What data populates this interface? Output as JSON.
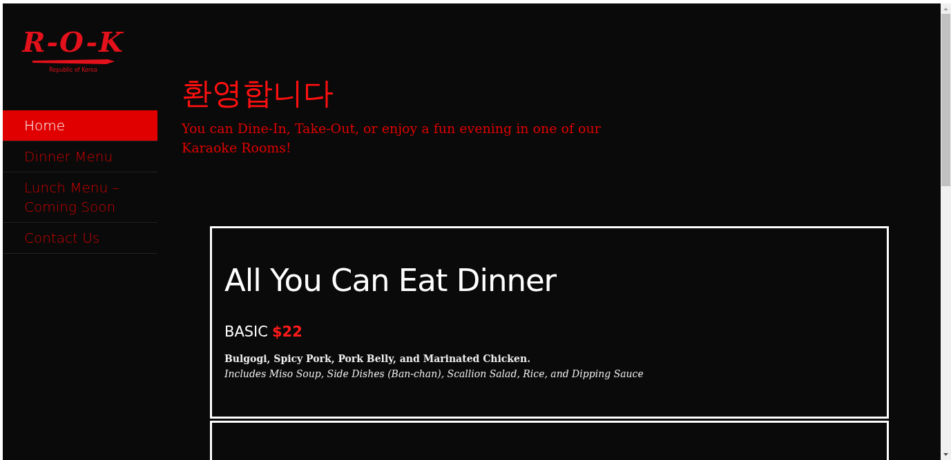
{
  "logo": {
    "text": "R-O-K",
    "tagline": "Republic of Korea"
  },
  "nav": [
    {
      "label": "Home",
      "selected": true
    },
    {
      "label": "Dinner Menu",
      "selected": false
    },
    {
      "label": "Lunch Menu – Coming Soon",
      "selected": false
    },
    {
      "label": "Contact Us",
      "selected": false
    }
  ],
  "welcome": {
    "title": "환영합니다",
    "text": "You can Dine-In, Take-Out, or enjoy a fun evening in one of our Karaoke Rooms!"
  },
  "menu_cards": [
    {
      "title": "All You Can Eat Dinner",
      "tier": "BASIC",
      "price": "$22",
      "items": "Bulgogi, Spicy Pork, Pork Belly, and Marinated Chicken.",
      "includes": "Includes Miso Soup, Side Dishes (Ban-chan), Scallion Salad, Rice, and Dipping Sauce"
    }
  ]
}
